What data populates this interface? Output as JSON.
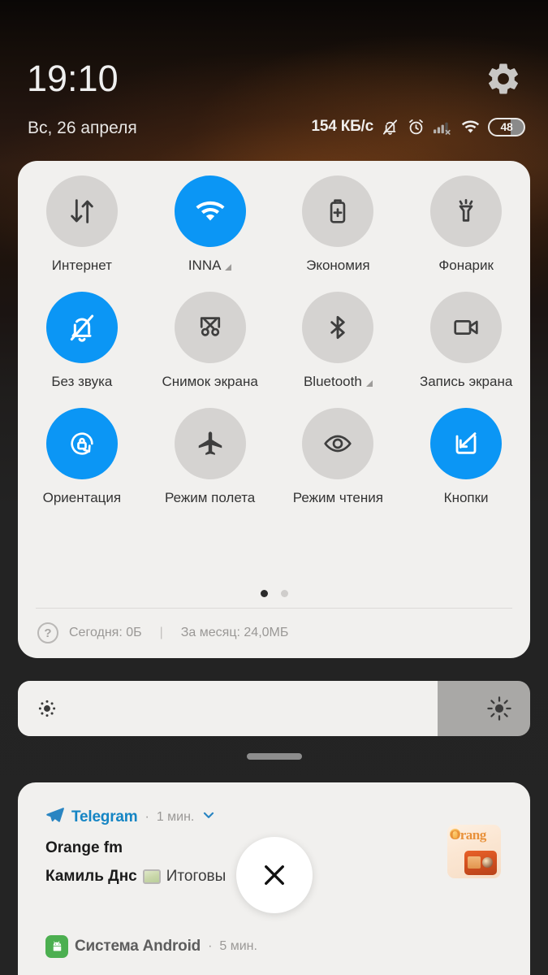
{
  "statusbar": {
    "clock": "19:10",
    "date": "Вс, 26 апреля",
    "network_speed": "154 КБ/с",
    "battery_level": "48",
    "icons": [
      "bell-muted-icon",
      "alarm-clock-icon",
      "signal-no-service-icon",
      "wifi-icon",
      "battery-icon"
    ],
    "settings_icon": "gear-icon"
  },
  "quick_settings": {
    "tiles": [
      {
        "label": "Интернет",
        "icon": "data-transfer-icon",
        "active": false,
        "has_chevron": false
      },
      {
        "label": "INNA",
        "icon": "wifi-icon",
        "active": true,
        "has_chevron": true
      },
      {
        "label": "Экономия",
        "icon": "battery-saver-icon",
        "active": false,
        "has_chevron": false
      },
      {
        "label": "Фонарик",
        "icon": "flashlight-icon",
        "active": false,
        "has_chevron": false
      },
      {
        "label": "Без звука",
        "icon": "bell-muted-icon",
        "active": true,
        "has_chevron": false
      },
      {
        "label": "Снимок экрана",
        "icon": "screenshot-icon",
        "active": false,
        "has_chevron": false
      },
      {
        "label": "Bluetooth",
        "icon": "bluetooth-icon",
        "active": false,
        "has_chevron": true
      },
      {
        "label": "Запись экрана",
        "icon": "screen-record-icon",
        "active": false,
        "has_chevron": false
      },
      {
        "label": "Ориентация",
        "icon": "rotation-lock-icon",
        "active": true,
        "has_chevron": false
      },
      {
        "label": "Режим полета",
        "icon": "airplane-icon",
        "active": false,
        "has_chevron": false
      },
      {
        "label": "Режим чтения",
        "icon": "eye-icon",
        "active": false,
        "has_chevron": false
      },
      {
        "label": "Кнопки",
        "icon": "buttons-icon",
        "active": true,
        "has_chevron": false
      }
    ],
    "pages": {
      "count": 2,
      "current": 1
    },
    "data_usage": {
      "help_glyph": "?",
      "today": "Сегодня: 0Б",
      "separator": "|",
      "month": "За месяц: 24,0МБ"
    },
    "colors": {
      "active": "#0b96f5",
      "inactive": "#d5d3d1",
      "panel": "#f1f0ee"
    }
  },
  "brightness": {
    "value_percent": 82,
    "low_icon": "brightness-low-icon",
    "high_icon": "brightness-high-icon"
  },
  "notifications": [
    {
      "app": "Telegram",
      "app_icon": "telegram-icon",
      "time": "1 мин.",
      "separator": "·",
      "expand_icon": "chevron-down-icon",
      "title": "Orange fm",
      "sender": "Камиль Днс",
      "attachment_icon": "image-icon",
      "body": "Итоговы",
      "thumbnail": {
        "name": "orange-fm-thumbnail",
        "text": "Orang"
      }
    },
    {
      "app": "Система Android",
      "app_icon": "android-icon",
      "time": "5 мин.",
      "separator": "·"
    }
  ],
  "close_button": {
    "icon": "close-icon",
    "label": "✕"
  }
}
